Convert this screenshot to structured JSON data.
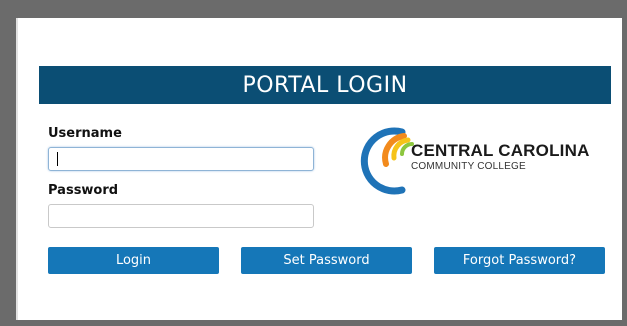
{
  "header": {
    "title": "PORTAL LOGIN"
  },
  "form": {
    "username_label": "Username",
    "username_value": "",
    "password_label": "Password",
    "password_value": ""
  },
  "buttons": {
    "login": "Login",
    "set_password": "Set Password",
    "forgot_password": "Forgot Password?"
  },
  "logo": {
    "line1": "CENTRAL CAROLINA",
    "line2": "COMMUNITY COLLEGE",
    "colors": [
      "#1f73b7",
      "#f28a1c",
      "#f6c319",
      "#8cc63e"
    ]
  },
  "colors": {
    "header_bg": "#0b4e74",
    "button_bg": "#1577b8"
  }
}
